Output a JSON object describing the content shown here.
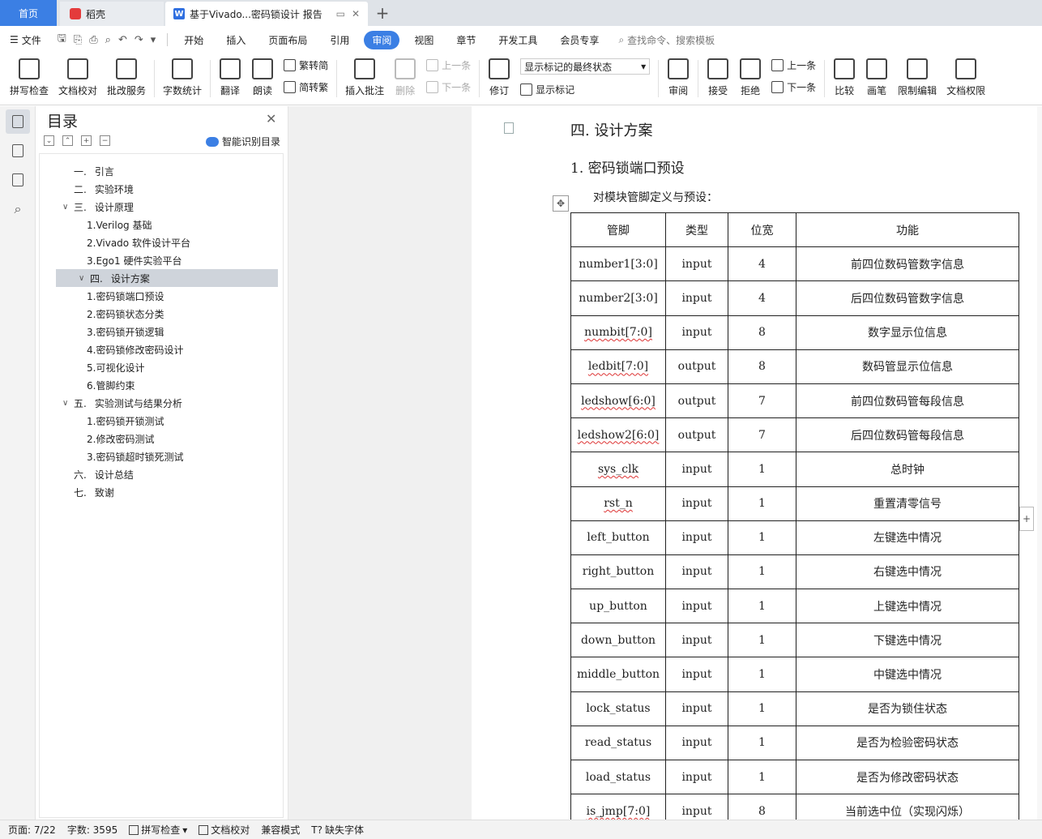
{
  "tabs": {
    "home": "首页",
    "daoke": "稻壳",
    "doc": "基于Vivado...密码锁设计 报告"
  },
  "menu": {
    "file": "文件",
    "tabs": [
      "开始",
      "插入",
      "页面布局",
      "引用",
      "审阅",
      "视图",
      "章节",
      "开发工具",
      "会员专享"
    ],
    "active_tab": "审阅",
    "search": "查找命令、搜索模板"
  },
  "ribbon": {
    "spell": "拼写检查",
    "doc_check": "文档校对",
    "revise_service": "批改服务",
    "word_count": "字数统计",
    "translate": "翻译",
    "read_aloud": "朗读",
    "trad_to_simp": "繁转简",
    "simp_to_trad": "简转繁",
    "insert_comment": "插入批注",
    "delete": "删除",
    "prev_comment": "上一条",
    "next_comment": "下一条",
    "track": "修订",
    "markup_state": "显示标记的最终状态",
    "show_markup": "显示标记",
    "review": "审阅",
    "accept": "接受",
    "reject": "拒绝",
    "prev_change": "上一条",
    "next_change": "下一条",
    "compare": "比较",
    "pen": "画笔",
    "restrict_edit": "限制编辑",
    "doc_perm": "文档权限"
  },
  "toc": {
    "title": "目录",
    "smart": "智能识别目录",
    "items": [
      {
        "num": "一.",
        "text": "引言",
        "level": 1
      },
      {
        "num": "二.",
        "text": "实验环境",
        "level": 1
      },
      {
        "num": "三.",
        "text": "设计原理",
        "level": 1,
        "expanded": true
      },
      {
        "num": "",
        "text": "1.Verilog 基础",
        "level": 2
      },
      {
        "num": "",
        "text": "2.Vivado 软件设计平台",
        "level": 2
      },
      {
        "num": "",
        "text": "3.Ego1 硬件实验平台",
        "level": 2
      },
      {
        "num": "四.",
        "text": "设计方案",
        "level": 1,
        "expanded": true,
        "active": true
      },
      {
        "num": "",
        "text": "1.密码锁端口预设",
        "level": 2
      },
      {
        "num": "",
        "text": "2.密码锁状态分类",
        "level": 2
      },
      {
        "num": "",
        "text": "3.密码锁开锁逻辑",
        "level": 2
      },
      {
        "num": "",
        "text": "4.密码锁修改密码设计",
        "level": 2
      },
      {
        "num": "",
        "text": "5.可视化设计",
        "level": 2
      },
      {
        "num": "",
        "text": "6.管脚约束",
        "level": 2
      },
      {
        "num": "五.",
        "text": "实验测试与结果分析",
        "level": 1,
        "expanded": true
      },
      {
        "num": "",
        "text": "1.密码锁开锁测试",
        "level": 2
      },
      {
        "num": "",
        "text": "2.修改密码测试",
        "level": 2
      },
      {
        "num": "",
        "text": "3.密码锁超时锁死测试",
        "level": 2
      },
      {
        "num": "六.",
        "text": "设计总结",
        "level": 1
      },
      {
        "num": "七.",
        "text": "致谢",
        "level": 1
      }
    ]
  },
  "document": {
    "heading": "四.  设计方案",
    "subheading": "1. 密码锁端口预设",
    "paragraph": "对模块管脚定义与预设：",
    "table": {
      "headers": [
        "管脚",
        "类型",
        "位宽",
        "功能"
      ],
      "rows": [
        [
          "number1[3:0]",
          "input",
          "4",
          "前四位数码管数字信息"
        ],
        [
          "number2[3:0]",
          "input",
          "4",
          "后四位数码管数字信息"
        ],
        [
          "numbit[7:0]",
          "input",
          "8",
          "数字显示位信息"
        ],
        [
          "ledbit[7:0]",
          "output",
          "8",
          "数码管显示位信息"
        ],
        [
          "ledshow[6:0]",
          "output",
          "7",
          "前四位数码管每段信息"
        ],
        [
          "ledshow2[6:0]",
          "output",
          "7",
          "后四位数码管每段信息"
        ],
        [
          "sys_clk",
          "input",
          "1",
          "总时钟"
        ],
        [
          "rst_n",
          "input",
          "1",
          "重置清零信号"
        ],
        [
          "left_button",
          "input",
          "1",
          "左键选中情况"
        ],
        [
          "right_button",
          "input",
          "1",
          "右键选中情况"
        ],
        [
          "up_button",
          "input",
          "1",
          "上键选中情况"
        ],
        [
          "down_button",
          "input",
          "1",
          "下键选中情况"
        ],
        [
          "middle_button",
          "input",
          "1",
          "中键选中情况"
        ],
        [
          "lock_status",
          "input",
          "1",
          "是否为锁住状态"
        ],
        [
          "read_status",
          "input",
          "1",
          "是否为检验密码状态"
        ],
        [
          "load_status",
          "input",
          "1",
          "是否为修改密码状态"
        ],
        [
          "is_jmp[7:0]",
          "input",
          "8",
          "当前选中位（实现闪烁）"
        ]
      ]
    }
  },
  "status": {
    "page": "页面: 7/22",
    "words": "字数: 3595",
    "spell": "拼写检查",
    "doc_check": "文档校对",
    "compat": "兼容模式",
    "missing_font": "缺失字体"
  }
}
